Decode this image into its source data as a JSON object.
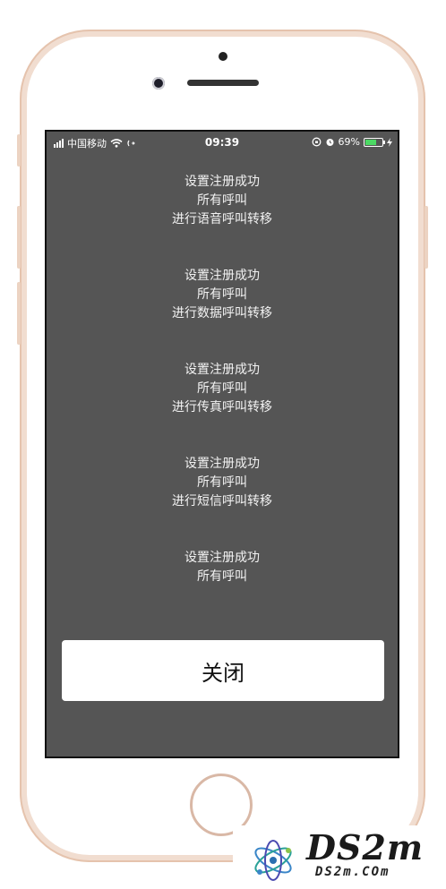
{
  "status_bar": {
    "carrier": "中国移动",
    "time": "09:39",
    "battery_percent": "69%",
    "battery_level": 0.69,
    "battery_color": "#4cd964"
  },
  "messages": [
    {
      "line1": "设置注册成功",
      "line2": "所有呼叫",
      "line3": "进行语音呼叫转移"
    },
    {
      "line1": "设置注册成功",
      "line2": "所有呼叫",
      "line3": "进行数据呼叫转移"
    },
    {
      "line1": "设置注册成功",
      "line2": "所有呼叫",
      "line3": "进行传真呼叫转移"
    },
    {
      "line1": "设置注册成功",
      "line2": "所有呼叫",
      "line3": "进行短信呼叫转移"
    },
    {
      "line1": "设置注册成功",
      "line2": "所有呼叫",
      "line3": ""
    }
  ],
  "close_button": {
    "label": "关闭"
  },
  "watermark": {
    "title": "DS2m",
    "subtitle": "DS2m.COm"
  },
  "colors": {
    "screen_bg": "#555555",
    "phone_frame": "#f1ddd0"
  }
}
